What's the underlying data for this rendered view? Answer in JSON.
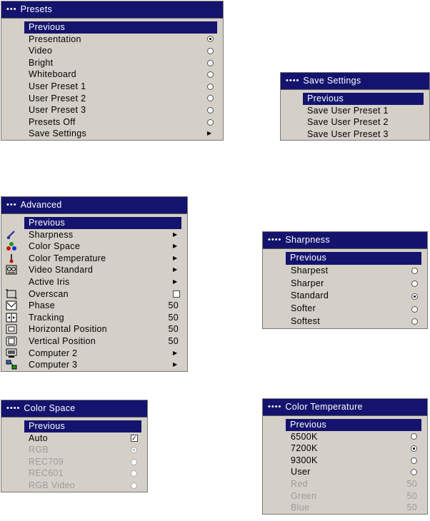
{
  "presets": {
    "title": "Presets",
    "items": [
      {
        "label": "Previous",
        "selected": true
      },
      {
        "label": "Presentation",
        "control": "radio",
        "checked": true
      },
      {
        "label": "Video",
        "control": "radio"
      },
      {
        "label": "Bright",
        "control": "radio"
      },
      {
        "label": "Whiteboard",
        "control": "radio"
      },
      {
        "label": "User Preset 1",
        "control": "radio"
      },
      {
        "label": "User Preset 2",
        "control": "radio"
      },
      {
        "label": "User Preset 3",
        "control": "radio"
      },
      {
        "label": "Presets Off",
        "control": "radio"
      },
      {
        "label": "Save Settings",
        "control": "arrow"
      }
    ]
  },
  "save_settings": {
    "title": "Save Settings",
    "items": [
      {
        "label": "Previous",
        "selected": true
      },
      {
        "label": "Save User Preset 1"
      },
      {
        "label": "Save User Preset 2"
      },
      {
        "label": "Save User Preset 3"
      }
    ]
  },
  "advanced": {
    "title": "Advanced",
    "items": [
      {
        "label": "Previous",
        "selected": true
      },
      {
        "label": "Sharpness",
        "control": "arrow",
        "icon": "sharpness-icon"
      },
      {
        "label": "Color Space",
        "control": "arrow",
        "icon": "color-space-icon"
      },
      {
        "label": "Color Temperature",
        "control": "arrow",
        "icon": "thermometer-icon"
      },
      {
        "label": "Video Standard",
        "control": "arrow",
        "icon": "video-standard-icon"
      },
      {
        "label": "Active Iris",
        "control": "arrow"
      },
      {
        "label": "Overscan",
        "control": "checkbox",
        "icon": "overscan-icon"
      },
      {
        "label": "Phase",
        "value": "50",
        "icon": "phase-icon"
      },
      {
        "label": "Tracking",
        "value": "50",
        "icon": "tracking-icon"
      },
      {
        "label": "Horizontal Position",
        "value": "50",
        "icon": "horizontal-position-icon"
      },
      {
        "label": "Vertical Position",
        "value": "50",
        "icon": "vertical-position-icon"
      },
      {
        "label": "Computer 2",
        "control": "arrow",
        "icon": "computer-icon"
      },
      {
        "label": "Computer 3",
        "control": "arrow",
        "icon": "network-icon"
      }
    ]
  },
  "sharpness": {
    "title": "Sharpness",
    "items": [
      {
        "label": "Previous",
        "selected": true
      },
      {
        "label": "Sharpest",
        "control": "radio"
      },
      {
        "label": "Sharper",
        "control": "radio"
      },
      {
        "label": "Standard",
        "control": "radio",
        "checked": true
      },
      {
        "label": "Softer",
        "control": "radio"
      },
      {
        "label": "Softest",
        "control": "radio"
      }
    ]
  },
  "color_space": {
    "title": "Color Space",
    "items": [
      {
        "label": "Previous",
        "selected": true
      },
      {
        "label": "Auto",
        "control": "checkbox",
        "checked": true
      },
      {
        "label": "RGB",
        "control": "radio",
        "checked": true,
        "disabled": true
      },
      {
        "label": "REC709",
        "control": "radio",
        "disabled": true
      },
      {
        "label": "REC601",
        "control": "radio",
        "disabled": true
      },
      {
        "label": "RGB Video",
        "control": "radio",
        "disabled": true
      }
    ]
  },
  "color_temperature": {
    "title": "Color Temperature",
    "items": [
      {
        "label": "Previous",
        "selected": true
      },
      {
        "label": "6500K",
        "control": "radio"
      },
      {
        "label": "7200K",
        "control": "radio",
        "checked": true
      },
      {
        "label": "9300K",
        "control": "radio"
      },
      {
        "label": "User",
        "control": "radio"
      },
      {
        "label": "Red",
        "value": "50",
        "disabled": true
      },
      {
        "label": "Green",
        "value": "50",
        "disabled": true
      },
      {
        "label": "Blue",
        "value": "50",
        "disabled": true
      }
    ]
  },
  "colors": {
    "title_bar": "#14146e",
    "menu_bg": "#d4d0c8",
    "disabled_text": "#9c9c9c"
  }
}
